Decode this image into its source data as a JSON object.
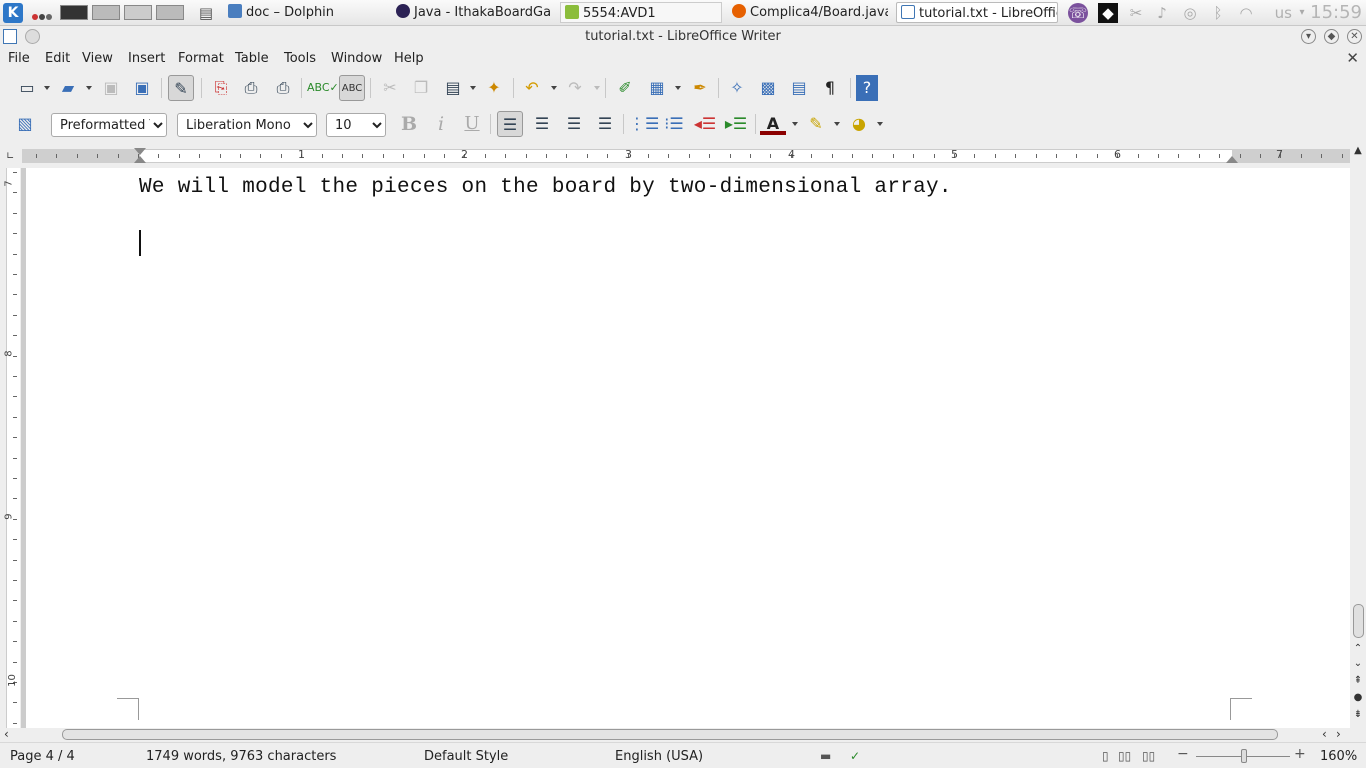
{
  "panel": {
    "tasks": [
      {
        "label": "doc – Dolphin"
      },
      {
        "label": "Java - IthakaBoardGam"
      },
      {
        "label": "5554:AVD1"
      },
      {
        "label": "Complica4/Board.java"
      },
      {
        "label": "tutorial.txt - LibreOffic"
      }
    ],
    "keyboard_layout": "us",
    "clock": "15:59"
  },
  "window": {
    "title": "tutorial.txt - LibreOffice Writer"
  },
  "menu": [
    "File",
    "Edit",
    "View",
    "Insert",
    "Format",
    "Table",
    "Tools",
    "Window",
    "Help"
  ],
  "formatting": {
    "paragraph_style": "Preformatted Text",
    "font_name": "Liberation Mono",
    "font_size": "10"
  },
  "ruler": {
    "labels": [
      "1",
      "2",
      "3",
      "4",
      "5",
      "6",
      "7"
    ],
    "vertical_labels": [
      "7",
      "8",
      "9",
      "10"
    ]
  },
  "document": {
    "text_line": "We will model the pieces on the board by two-dimensional array."
  },
  "status": {
    "page": "Page 4 / 4",
    "word_count": "1749 words, 9763 characters",
    "page_style": "Default Style",
    "language": "English (USA)",
    "zoom": "160%"
  },
  "colors": {
    "accent": "#2d77c8",
    "toolbar_bg": "#eeeeee"
  }
}
